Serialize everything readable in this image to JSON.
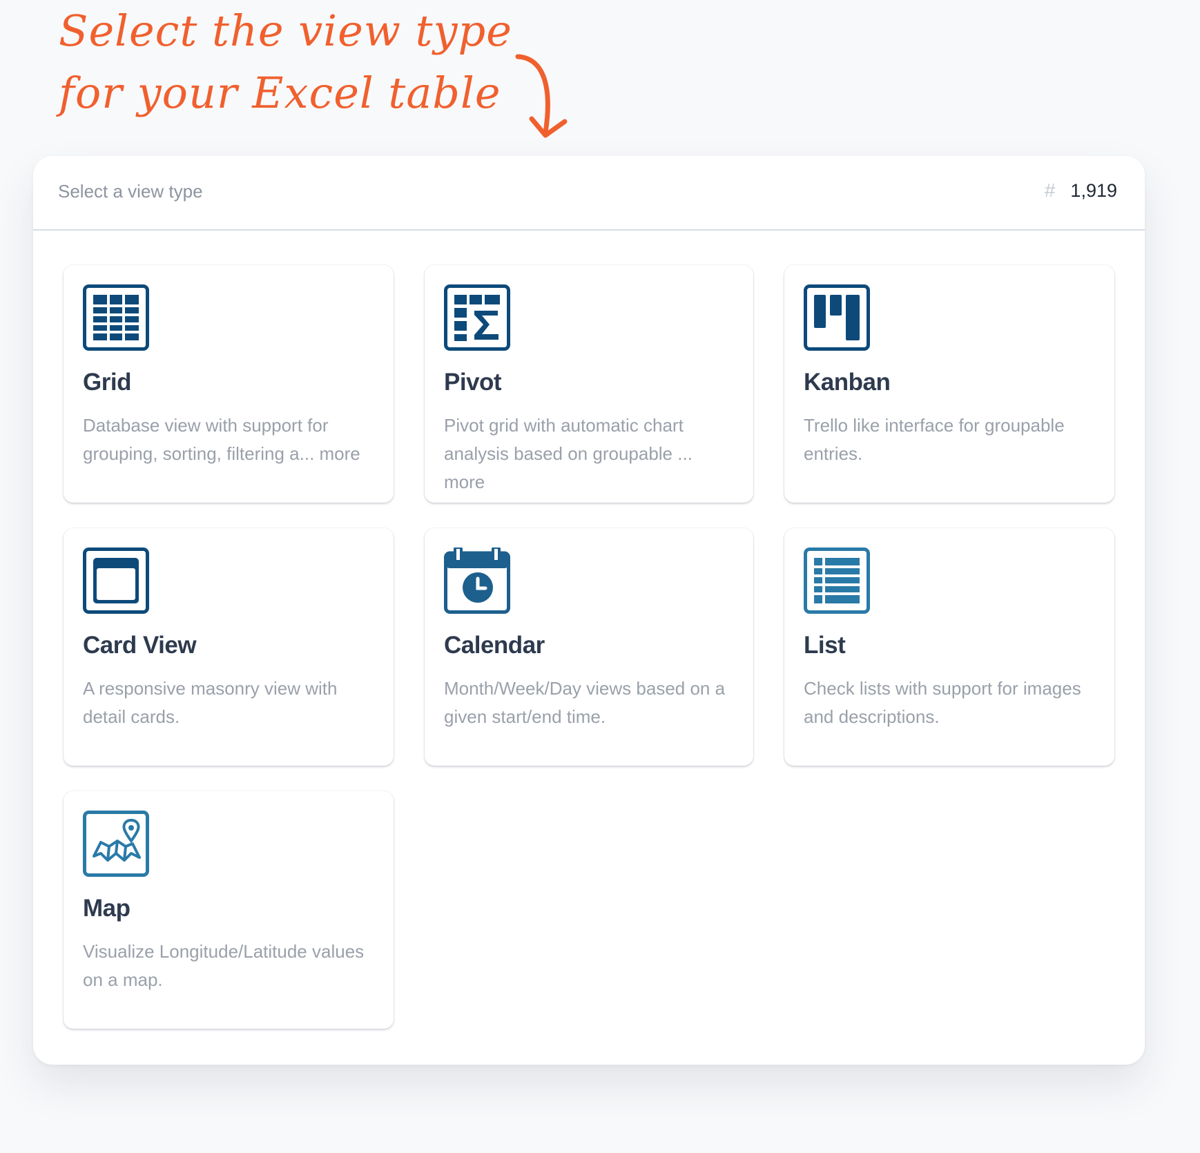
{
  "annotation": {
    "line1": "Select the view type",
    "line2": "for your Excel table"
  },
  "panel": {
    "title": "Select a view type",
    "count_icon": "hash-icon",
    "count": "1,919"
  },
  "colors": {
    "accent": "#f0602e",
    "icon_dark": "#0d4a7a",
    "icon_light": "#2a7aa8"
  },
  "views": [
    {
      "name": "Grid",
      "icon": "grid-table-icon",
      "desc": "Database view with support for grouping, sorting, filtering a... more"
    },
    {
      "name": "Pivot",
      "icon": "pivot-sum-icon",
      "desc": "Pivot grid with automatic chart analysis based on groupable ... more"
    },
    {
      "name": "Kanban",
      "icon": "kanban-board-icon",
      "desc": "Trello like interface for groupable entries."
    },
    {
      "name": "Card View",
      "icon": "card-window-icon",
      "desc": "A responsive masonry view with detail cards."
    },
    {
      "name": "Calendar",
      "icon": "calendar-clock-icon",
      "desc": "Month/Week/Day views based on a given start/end time."
    },
    {
      "name": "List",
      "icon": "list-lines-icon",
      "desc": "Check lists with support for images and descriptions."
    },
    {
      "name": "Map",
      "icon": "map-pin-icon",
      "desc": "Visualize Longitude/Latitude values on a map."
    }
  ]
}
